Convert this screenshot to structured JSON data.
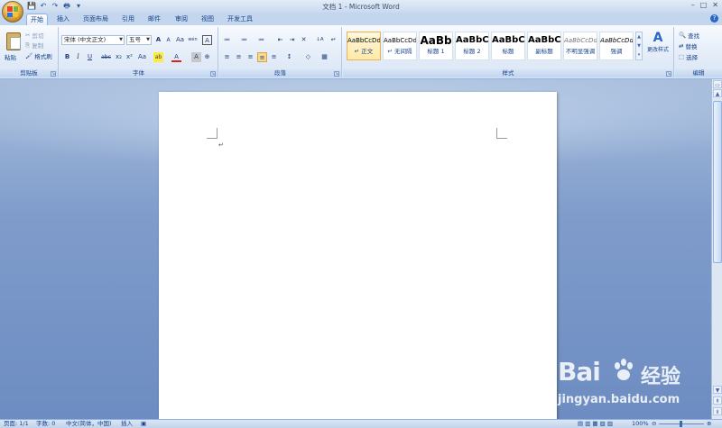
{
  "window": {
    "title": "文档 1 - Microsoft Word",
    "controls": [
      "–",
      "□",
      "✕"
    ]
  },
  "qat": [
    "💾",
    "↶",
    "↷",
    "🖶",
    "▾"
  ],
  "tabs": [
    "开始",
    "插入",
    "页面布局",
    "引用",
    "邮件",
    "审阅",
    "视图",
    "开发工具"
  ],
  "active_tab": "开始",
  "clipboard": {
    "paste": "粘贴",
    "cut": "剪切",
    "copy": "复制",
    "format_painter": "格式刷",
    "label": "剪贴板"
  },
  "font": {
    "name": "宋体 (中文正文)",
    "size": "五号",
    "label": "字体",
    "row1_buttons": [
      "A",
      "A",
      "Aa",
      "wén",
      "A"
    ],
    "row2_buttons": [
      "B",
      "I",
      "U",
      "abc",
      "x₂",
      "x²",
      "Aa",
      "ab",
      "A",
      "A",
      "⊕"
    ]
  },
  "paragraph": {
    "label": "段落",
    "row1_buttons": [
      "≔",
      "≔",
      "≔",
      "⇤",
      "⇥",
      "✕",
      "↓A",
      "↵"
    ],
    "row2_buttons": [
      "≡",
      "≡",
      "≡",
      "≡",
      "≡",
      "↕",
      "◇",
      "▦"
    ]
  },
  "styles": {
    "label": "样式",
    "tiles": [
      {
        "preview": "AaBbCcDd",
        "name": "↵ 正文"
      },
      {
        "preview": "AaBbCcDd",
        "name": "↵ 无间隔"
      },
      {
        "preview": "AaBb",
        "name": "标题 1"
      },
      {
        "preview": "AaBbC",
        "name": "标题 2"
      },
      {
        "preview": "AaBbC",
        "name": "标题"
      },
      {
        "preview": "AaBbC",
        "name": "副标题"
      },
      {
        "preview": "AaBbCcDd",
        "name": "不明显强调"
      },
      {
        "preview": "AaBbCcDd",
        "name": "强调"
      }
    ],
    "change_styles": "更改样式"
  },
  "editing": {
    "label": "编辑",
    "find": "查找",
    "replace": "替换",
    "select": "选择"
  },
  "document": {
    "paragraph_mark": "↵"
  },
  "statusbar": {
    "page": "页面: 1/1",
    "words": "字数: 0",
    "language": "中文(简体，中国)",
    "mode": "插入",
    "zoom": "100%"
  },
  "watermark": {
    "brand": "Bai",
    "brand_cn": "经验",
    "url": "jingyan.baidu.com"
  },
  "colors": {
    "ribbon_text": "#15428b",
    "doc_bg": "#7f9ccb",
    "accent": "#f0b04c"
  }
}
